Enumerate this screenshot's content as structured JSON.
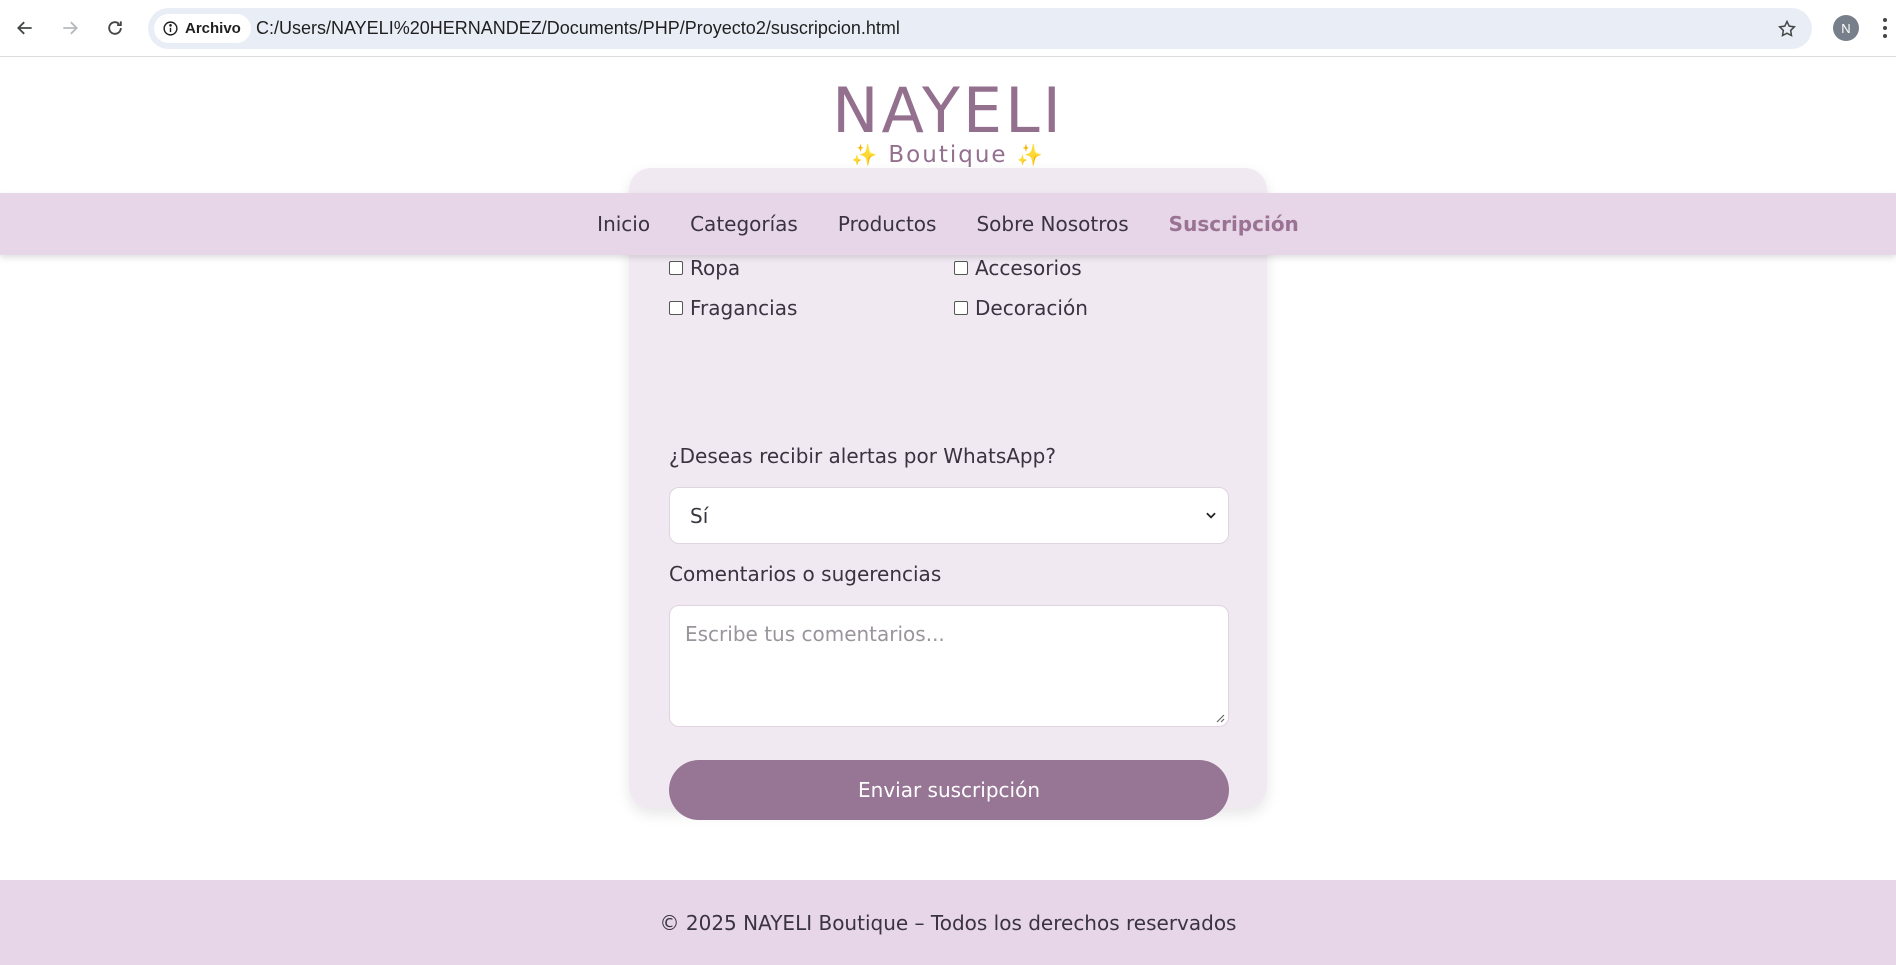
{
  "browser": {
    "site_chip_label": "Archivo",
    "url": "C:/Users/NAYELI%20HERNANDEZ/Documents/PHP/Proyecto2/suscripcion.html",
    "profile_initial": "N",
    "icons": [
      "back-arrow-icon",
      "forward-arrow-icon",
      "reload-icon",
      "info-icon",
      "star-icon",
      "kebab-menu-icon"
    ]
  },
  "header": {
    "logo": "NAYELI",
    "tagline_sparkle": "✨",
    "tagline": "Boutique"
  },
  "nav": {
    "items": [
      {
        "label": "Inicio",
        "active": false
      },
      {
        "label": "Categorías",
        "active": false
      },
      {
        "label": "Productos",
        "active": false
      },
      {
        "label": "Sobre Nosotros",
        "active": false
      },
      {
        "label": "Suscripción",
        "active": true
      }
    ]
  },
  "form": {
    "interests": [
      {
        "label": "Ropa",
        "checked": false
      },
      {
        "label": "Accesorios",
        "checked": false
      },
      {
        "label": "Fragancias",
        "checked": false
      },
      {
        "label": "Decoración",
        "checked": false
      }
    ],
    "whatsapp_label": "¿Deseas recibir alertas por WhatsApp?",
    "whatsapp_value": "Sí",
    "comments_label": "Comentarios o sugerencias",
    "comments_placeholder": "Escribe tus comentarios...",
    "submit_label": "Enviar suscripción"
  },
  "footer": {
    "text": "© 2025 NAYELI Boutique – Todos los derechos reservados"
  },
  "colors": {
    "brand": "#94708f",
    "nav_bg": "#e7d6e8",
    "card_bg": "#f1e9f2",
    "button_bg": "#977594",
    "sparkle": "#f2b01e"
  }
}
